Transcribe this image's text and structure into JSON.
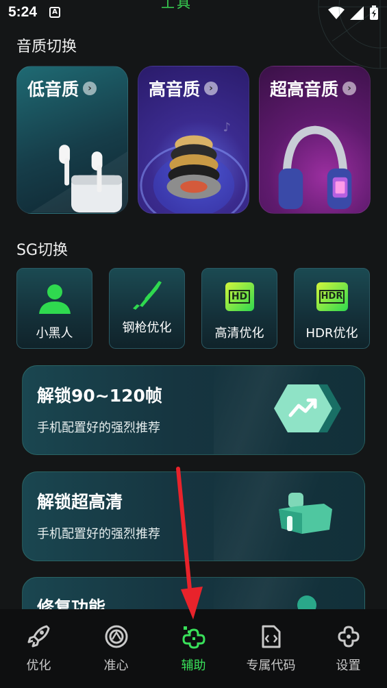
{
  "status_bar": {
    "time": "5:24",
    "notif_icon_text": "A"
  },
  "header": {
    "title_fragment": "工具"
  },
  "sections": {
    "quality_title": "音质切换",
    "sg_title": "SG切换"
  },
  "quality_cards": [
    {
      "label": "低音质"
    },
    {
      "label": "高音质"
    },
    {
      "label": "超高音质"
    }
  ],
  "sg_cards": [
    {
      "label": "小黑人",
      "icon": "person-icon"
    },
    {
      "label": "钢枪优化",
      "icon": "rifle-icon"
    },
    {
      "label": "高清优化",
      "icon": "hd-badge-icon",
      "badge": "HD"
    },
    {
      "label": "HDR优化",
      "icon": "hdr-badge-icon",
      "badge": "HDR"
    }
  ],
  "feature_cards": [
    {
      "title": "解锁90~120帧",
      "subtitle": "手机配置好的强烈推荐",
      "icon": "trend-hexagon-icon"
    },
    {
      "title": "解锁超高清",
      "subtitle": "手机配置好的强烈推荐",
      "icon": "cube-icon"
    },
    {
      "title": "修复功能",
      "subtitle": "",
      "icon": "repair-icon"
    }
  ],
  "bottom_nav": [
    {
      "label": "优化",
      "icon": "rocket-icon",
      "active": false
    },
    {
      "label": "准心",
      "icon": "crosshair-icon",
      "active": false
    },
    {
      "label": "辅助",
      "icon": "puzzle-icon",
      "active": true
    },
    {
      "label": "专属代码",
      "icon": "code-file-icon",
      "active": false
    },
    {
      "label": "设置",
      "icon": "settings-icon",
      "active": false
    }
  ],
  "colors": {
    "accent_green": "#39e05a",
    "background": "#141617",
    "arrow_red": "#e8232b"
  }
}
